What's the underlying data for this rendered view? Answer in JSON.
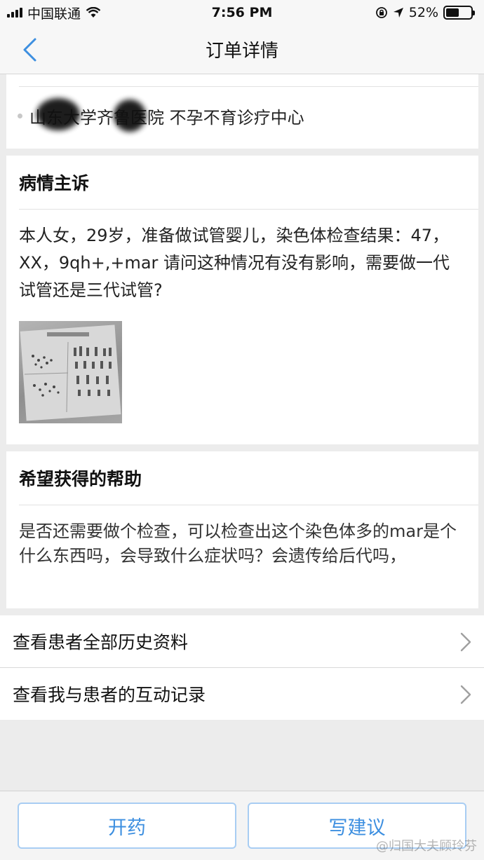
{
  "status_bar": {
    "carrier": "中国联通",
    "time": "7:56 PM",
    "battery_percent": "52%",
    "battery_level": 0.52
  },
  "nav": {
    "title": "订单详情"
  },
  "hospital": {
    "name": "山东大学齐鲁医院 不孕不育诊疗中心"
  },
  "complaint": {
    "title": "病情主诉",
    "text": "本人女，29岁，准备做试管婴儿，染色体检查结果：47，XX，9qh+,+mar 请问这种情况有没有影响，需要做一代试管还是三代试管?"
  },
  "help": {
    "title": "希望获得的帮助",
    "text": "是否还需要做个检查，可以检查出这个染色体多的mar是个什么东西吗，会导致什么症状吗？会遗传给后代吗，"
  },
  "links": [
    {
      "label": "查看患者全部历史资料",
      "icon": "chevron-right-icon"
    },
    {
      "label": "查看我与患者的互动记录",
      "icon": "chevron-right-icon"
    }
  ],
  "actions": {
    "prescribe_label": "开药",
    "advice_label": "写建议"
  },
  "watermark": "@归国大夫顾玲芬",
  "colors": {
    "accent": "#3d8fe0",
    "button_border": "#a8cdf3",
    "background": "#ececec"
  }
}
